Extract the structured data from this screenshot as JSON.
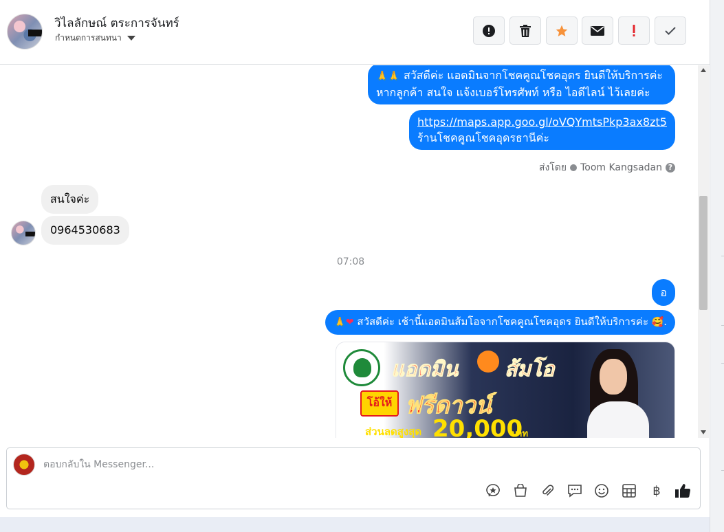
{
  "header": {
    "contact_name": "วิไลลักษณ์ ตระการจันทร์",
    "assign_label": "กำหนดการสนทนา",
    "actions": [
      "spam-report",
      "delete",
      "star",
      "mark-unread",
      "important",
      "done"
    ]
  },
  "messages": {
    "out_1_line1": "สวัสดีค่ะ แอดมินจากโชคคูณโชคอุดร ยินดีให้บริการค่ะ",
    "out_1_line2": "หากลูกค้า สนใจ แจ้งเบอร์โทรศัพท์ หรือ ไอดีไลน์  ไว้เลยค่ะ",
    "out_2_link": "https://maps.app.goo.gl/oVQYmtsPkp3ax8zt5",
    "out_2_line2": "ร้านโชคคูณโชคอุดรธานีค่ะ",
    "sent_by_prefix": "ส่งโดย",
    "sent_by_name": "Toom Kangsadan",
    "in_1": "สนใจค่ะ",
    "in_2": "0964530683",
    "time_divider": "07:08",
    "out_3": "อ",
    "out_4": "สวัสดีค่ะ เช้านี้แอดมินส้มโอจากโชคคูณโชคอุดร ยินดีให้บริการค่ะ",
    "out_4_suffix": "."
  },
  "promo": {
    "title_a": "แอดมิน",
    "title_b": "ส้มโอ",
    "badge": "โอ้ให้",
    "headline": "ฟรีดาวน์",
    "discount_label": "ส่วนลดสูงสุด",
    "discount_value": "20,000",
    "discount_unit": "บาท"
  },
  "composer": {
    "placeholder": "ตอบกลับใน Messenger..."
  },
  "colors": {
    "bubble_out": "#0a7cff",
    "bubble_in": "#f0f0f0",
    "star": "#f7923a",
    "important": "#e4262c"
  }
}
